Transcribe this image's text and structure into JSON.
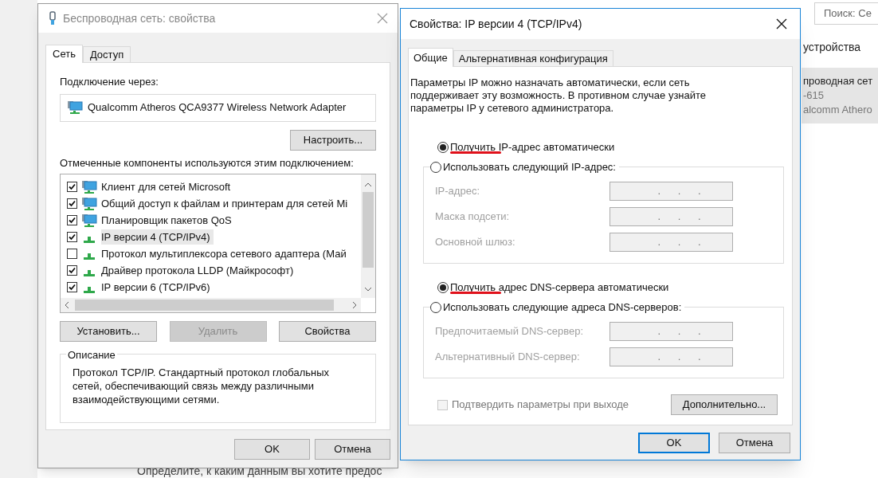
{
  "background_window": {
    "search_placeholder": "Поиск: Се",
    "section_title": "устройства",
    "selected_item": {
      "lines": [
        "проводная сет",
        "-615",
        "alcomm Athero"
      ]
    },
    "footer_text": "Определите, к каким данным вы хотите предос"
  },
  "wireless_dialog": {
    "title": "Беспроводная сеть: свойства",
    "tabs": [
      {
        "label": "Сеть",
        "selected": true
      },
      {
        "label": "Доступ",
        "selected": false
      }
    ],
    "connect_via_label": "Подключение через:",
    "adapter": "Qualcomm Atheros QCA9377 Wireless Network Adapter",
    "configure_button": "Настроить...",
    "components_label": "Отмеченные компоненты используются этим подключением:",
    "components": [
      {
        "label": "Клиент для сетей Microsoft",
        "checked": true,
        "selected": false,
        "kind": "monitor"
      },
      {
        "label": "Общий доступ к файлам и принтерам для сетей Mi",
        "checked": true,
        "selected": false,
        "kind": "monitor"
      },
      {
        "label": "Планировщик пакетов QoS",
        "checked": true,
        "selected": false,
        "kind": "monitor"
      },
      {
        "label": "IP версии 4 (TCP/IPv4)",
        "checked": true,
        "selected": true,
        "kind": "protocol"
      },
      {
        "label": "Протокол мультиплексора сетевого адаптера (Май",
        "checked": false,
        "selected": false,
        "kind": "protocol"
      },
      {
        "label": "Драйвер протокола LLDP (Майкрософт)",
        "checked": true,
        "selected": false,
        "kind": "protocol"
      },
      {
        "label": "IP версии 6 (TCP/IPv6)",
        "checked": true,
        "selected": false,
        "kind": "protocol"
      }
    ],
    "buttons": [
      {
        "label": "Установить...",
        "disabled": false
      },
      {
        "label": "Удалить",
        "disabled": true
      },
      {
        "label": "Свойства",
        "disabled": false
      }
    ],
    "description": {
      "title": "Описание",
      "text": "Протокол TCP/IP. Стандартный протокол глобальных сетей, обеспечивающий связь между различными взаимодействующими сетями."
    },
    "footer_buttons": [
      {
        "label": "OK",
        "default": false
      },
      {
        "label": "Отмена",
        "default": false
      }
    ]
  },
  "ipv4_dialog": {
    "title": "Свойства: IP версии 4 (TCP/IPv4)",
    "tabs": [
      {
        "label": "Общие",
        "selected": true
      },
      {
        "label": "Альтернативная конфигурация",
        "selected": false
      }
    ],
    "intro": "Параметры IP можно назначать автоматически, если сеть поддерживает эту возможность. В противном случае узнайте параметры IP у сетевого администратора.",
    "ip_section": {
      "auto_option": {
        "label": "Получить IP-адрес автоматически",
        "selected": true,
        "underlined": true
      },
      "manual_option": {
        "label": "Использовать следующий IP-адрес:",
        "selected": false
      },
      "disabled": true,
      "fields": [
        {
          "label": "IP-адрес:",
          "value": ".      .      ."
        },
        {
          "label": "Маска подсети:",
          "value": ".      .      ."
        },
        {
          "label": "Основной шлюз:",
          "value": ".      .      ."
        }
      ]
    },
    "dns_section": {
      "auto_option": {
        "label": "Получить адрес DNS-сервера автоматически",
        "selected": true,
        "underlined": true
      },
      "manual_option": {
        "label": "Использовать следующие адреса DNS-серверов:",
        "selected": false
      },
      "disabled": true,
      "fields": [
        {
          "label": "Предпочитаемый DNS-сервер:",
          "value": ".      .      ."
        },
        {
          "label": "Альтернативный DNS-сервер:",
          "value": ".      .      ."
        }
      ]
    },
    "validate_checkbox": {
      "label": "Подтвердить параметры при выходе",
      "checked": false,
      "disabled": true
    },
    "advanced_button": "Дополнительно...",
    "footer_buttons": [
      {
        "label": "OK",
        "default": true
      },
      {
        "label": "Отмена",
        "default": false
      }
    ]
  }
}
